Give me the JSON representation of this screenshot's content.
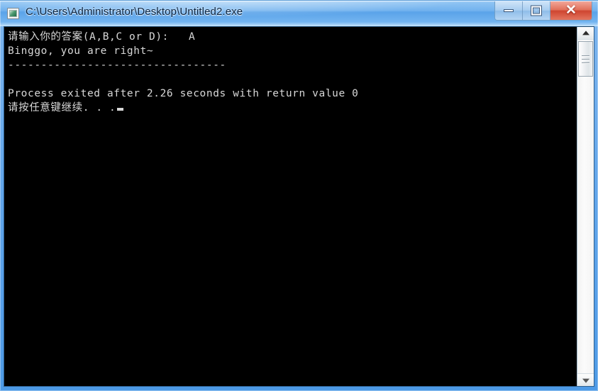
{
  "window": {
    "title": "C:\\Users\\Administrator\\Desktop\\Untitled2.exe",
    "app_icon": "console-window-icon",
    "frame_color": "#5f9fd8",
    "titlebar_color": "#72b2ee"
  },
  "controls": {
    "minimize_label": "–",
    "maximize_label": "□",
    "close_label": "✕"
  },
  "console": {
    "background": "#000000",
    "foreground": "#d8d8d8",
    "lines": [
      "请输入你的答案(A,B,C or D):   A",
      "Binggo, you are right~",
      "---------------------------------",
      "Process exited after 2.26 seconds with return value 0",
      "请按任意键继续. . ."
    ],
    "prompt": "请输入你的答案(A,B,C or D):",
    "user_input": "A",
    "result_message": "Binggo, you are right~",
    "separator": "---------------------------------",
    "exit_message": "Process exited after 2.26 seconds with return value 0",
    "exit_seconds": "2.26",
    "return_value": "0",
    "continue_message": "请按任意键继续. . ."
  },
  "scrollbar": {
    "up_arrow": "scroll-up-arrow-icon",
    "down_arrow": "scroll-down-arrow-icon",
    "thumb": "scrollbar-thumb"
  }
}
